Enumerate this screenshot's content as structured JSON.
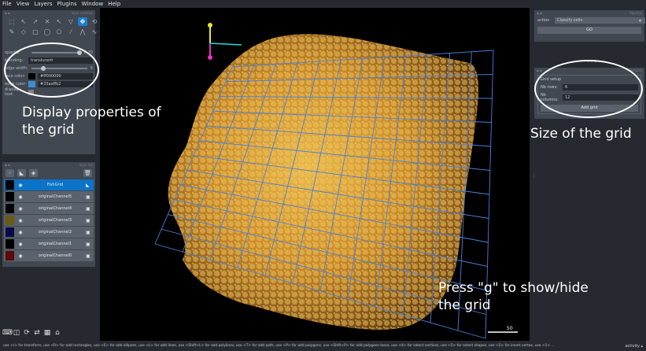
{
  "menu": {
    "file": "File",
    "view": "View",
    "layers": "Layers",
    "plugins": "Plugins",
    "window": "Window",
    "help": "Help"
  },
  "layer_controls": {
    "title": "layer controls",
    "opacity_label": "opacity:",
    "opacity_value": "0.70",
    "blending_label": "blending:",
    "blending_value": "translucent",
    "edge_width_label": "edge width:",
    "edge_width_value": "5",
    "face_color_label": "face color:",
    "face_color_value": "#ff000000",
    "edge_color_label": "edge color:",
    "edge_color_value": "#33aaff​b2",
    "edge_color_hex": "#33aaff",
    "display_text_label": "display text:"
  },
  "layer_list": {
    "title": "layer list",
    "layers": [
      "FishGrid",
      "originalChannel5",
      "originalChannel4",
      "originalChannel3",
      "originalChannel2",
      "originalChannel1",
      "originalChannel0"
    ]
  },
  "classify": {
    "title": "Pipeline",
    "action_label": "action",
    "action_value": "Classify cells",
    "go_label": "GO"
  },
  "grid_widget": {
    "title": "FishGrid",
    "group_label": "Grid setup",
    "rows_label": "Nb rows:",
    "rows_value": "6",
    "cols_label": "Nb columns:",
    "cols_value": "12",
    "add_label": "Add grid"
  },
  "annotations": {
    "display": "Display properties of the grid",
    "size": "Size of the grid",
    "press": "Press \"g\" to show/hide the grid"
  },
  "scale_bar": "50",
  "status_text": "use </> for transform, use <R> for add rectangles, use <E> for add ellipses, use <L> for add lines, use <Shift+L> for add polylines, use <T> for add path, use <P> for add polygons, use <Shift+P> for add polygons lasso, use <4> for select vertices, use <5> for select shapes, use <2> for insert vertex, use <1> ...",
  "activity": "activity ▴"
}
